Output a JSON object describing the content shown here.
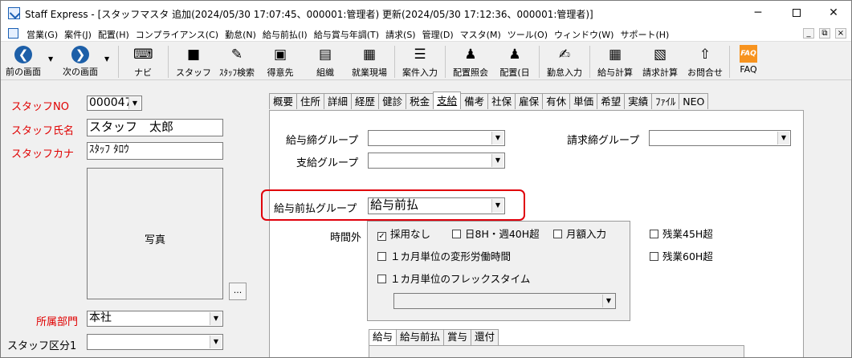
{
  "window": {
    "title": "Staff Express - [スタッフマスタ 追加(2024/05/30 17:07:45、000001:管理者) 更新(2024/05/30 17:12:36、000001:管理者)]",
    "minimize": "─",
    "close": "✕"
  },
  "menu": {
    "items": [
      "営業(G)",
      "案件(J)",
      "配置(H)",
      "コンプライアンス(C)",
      "勤怠(N)",
      "給与前払(I)",
      "給与賞与年調(T)",
      "請求(S)",
      "管理(D)",
      "マスタ(M)",
      "ツール(O)",
      "ウィンドウ(W)",
      "サポート(H)"
    ],
    "mdi": [
      "_",
      "⧉",
      "×"
    ]
  },
  "toolbar": {
    "prev": "前の画面",
    "next": "次の画面",
    "navi": "ナビ",
    "staff": "スタッフ",
    "staff_search": "ｽﾀｯﾌ検索",
    "client": "得意先",
    "org": "組織",
    "site": "就業現場",
    "job_entry": "案件入力",
    "assign_view": "配置照会",
    "assign_day": "配置(日",
    "attendance": "勤怠入力",
    "payroll": "給与計算",
    "billing": "請求計算",
    "contact": "お問合せ",
    "faq": "FAQ",
    "faq_icon": "FAQ"
  },
  "left": {
    "staff_no_label": "スタッフNO",
    "staff_no_value": "000047",
    "staff_name_label": "スタッフ氏名",
    "staff_name_value": "スタッフ　太郎",
    "staff_kana_label": "スタッフカナ",
    "staff_kana_value": "ｽﾀｯﾌ ﾀﾛｳ",
    "photo_label": "写真",
    "photo_button": "...",
    "dept_label": "所属部門",
    "dept_value": "本社",
    "staff_type_label": "スタッフ区分1",
    "staff_type_value": ""
  },
  "tabs": [
    "概要",
    "住所",
    "詳細",
    "経歴",
    "健診",
    "税金",
    "支給",
    "備考",
    "社保",
    "雇保",
    "有休",
    "単価",
    "希望",
    "実績",
    "ﾌｧｲﾙ",
    "NEO"
  ],
  "active_tab": "支給",
  "payment": {
    "pay_close_group_label": "給与締グループ",
    "pay_close_group_value": "",
    "pay_group_label": "支給グループ",
    "pay_group_value": "",
    "bill_close_group_label": "請求締グループ",
    "bill_close_group_value": "",
    "advance_group_label": "給与前払グループ",
    "advance_group_value": "給与前払",
    "overtime_label": "時間外",
    "checks": {
      "adopt_none": {
        "label": "採用なし",
        "checked": true
      },
      "day8_week40": {
        "label": "日8H・週40H超",
        "checked": false
      },
      "monthly_input": {
        "label": "月額入力",
        "checked": false
      },
      "over45": {
        "label": "残業45H超",
        "checked": false
      },
      "over60": {
        "label": "残業60H超",
        "checked": false
      },
      "variable_month": {
        "label": "１カ月単位の変形労働時間",
        "checked": false
      },
      "flex_month": {
        "label": "１カ月単位のフレックスタイム",
        "checked": false
      }
    },
    "flex_select_value": ""
  },
  "subtabs": [
    "給与",
    "給与前払",
    "賞与",
    "還付"
  ],
  "check_glyph": "✓",
  "arrow_glyph": "▼"
}
